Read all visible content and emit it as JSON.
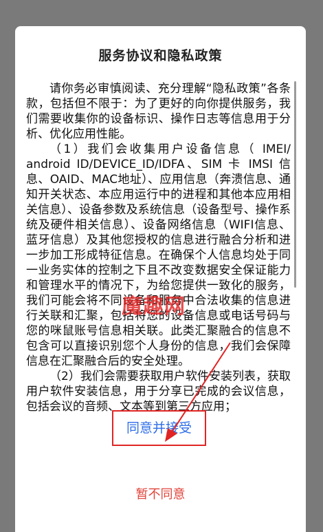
{
  "dialog": {
    "title": "服务协议和隐私政策",
    "paragraphs": [
      "请你务必审慎阅读、充分理解“隐私政策”各条款，包括但不限于：为了更好的向你提供服务，我们需要收集你的设备标识、操作日志等信息用于分析、优化应用性能。",
      "（1）我们会收集用户设备信息（ IMEI/ android ID/DEVICE_ID/IDFA、SIM 卡 IMSI 信息、OAID、MAC地址）、应用信息（奔溃信息、通知开关状态、本应用运行中的进程和其他本应用相关信息）、设备参数及系统信息（设备型号、操作系统及硬件相关信息）、设备网络信息（WIFI信息、蓝牙信息）及其他您授权的信息进行融合分析和进一步加工形成特征信息。在确保个人信息均处于同一业务实体的控制之下且不改变数据安全保证能力和管理水平的情况下，为给您提供一致化的服务，我们可能会将不同设备和服务中合法收集的信息进行关联和汇聚，包括将您的设备信息或电话号码与您的咪鼠账号信息相关联。此类汇聚融合的信息不包含可以直接识别您个人身份的信息，我们会保障信息在汇聚融合后的安全处理。",
      "（2）我们会需要获取用户软件安装列表，获取用户软件安装信息，用于分享已完成的会议信息，包括会议的音频、文本等到第三方应用；"
    ],
    "watermark": "魔趣网",
    "agree_label": "同意并接受",
    "disagree_label": "暂不同意"
  },
  "colors": {
    "agree_text": "#2f6ee8",
    "disagree_text": "#e0443a",
    "highlight_border": "#e02424",
    "overlay": "#7a7a7a"
  }
}
